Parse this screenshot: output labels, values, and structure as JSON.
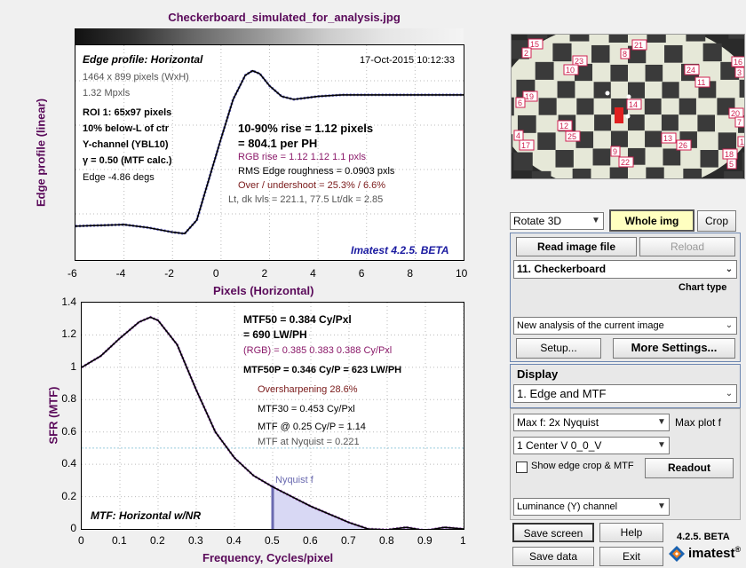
{
  "window_title": "Checkerboard_simulated_for_analysis.jpg",
  "edge_plot": {
    "title": "Edge profile: Horizontal",
    "timestamp": "17-Oct-2015 10:12:33",
    "dims": "1464 x 899 pixels (WxH)",
    "mpxls": "1.32 Mpxls",
    "roi": "ROI 1:  65x97 pixels",
    "pos": "10% below-L of ctr",
    "channel": "Y-channel  (YBL10)",
    "gamma": "γ = 0.50 (MTF calc.)",
    "edge_angle": "Edge -4.86 degs",
    "rise_1": "10-90% rise = 1.12 pixels",
    "rise_2": "= 804.1 per PH",
    "rgb_rise": "RGB rise = 1.12  1.12  1.1  pxls",
    "rms": "RMS Edge roughness = 0.0903 pxls",
    "over_under": "Over / undershoot = 25.3% / 6.6%",
    "levels": "Lt, dk lvls = 221.1, 77.5   Lt/dk = 2.85",
    "version": "Imatest 4.2.5. BETA",
    "ylabel": "Edge profile (linear)",
    "xlabel": "Pixels (Horizontal)",
    "xticks": [
      "-6",
      "-4",
      "-2",
      "0",
      "2",
      "4",
      "6",
      "8",
      "10"
    ]
  },
  "mtf_plot": {
    "mtf50_1": "MTF50 = 0.384 Cy/Pxl",
    "mtf50_2": "= 690 LW/PH",
    "rgb": "(RGB) = 0.385  0.383  0.388 Cy/Pxl",
    "mtf50p": "MTF50P = 0.346 Cy/P = 623 LW/PH",
    "oversharp": "Oversharpening 28.6%",
    "mtf30": "MTF30 = 0.453 Cy/Pxl",
    "mtf_at": "MTF @ 0.25 Cy/P = 1.14",
    "mtf_nyq": "MTF at Nyquist = 0.221",
    "nyquist_label": "Nyquist f",
    "bottom_title": "MTF: Horizontal w/NR",
    "ylabel": "SFR (MTF)",
    "xlabel": "Frequency, Cycles/pixel",
    "yticks": [
      "1.4",
      "1.2",
      "1",
      "0.8",
      "0.6",
      "0.4",
      "0.2",
      "0"
    ],
    "xticks": [
      "0",
      "0.1",
      "0.2",
      "0.3",
      "0.4",
      "0.5",
      "0.6",
      "0.7",
      "0.8",
      "0.9",
      "1"
    ]
  },
  "thumbnail_labels": [
    "15",
    "2",
    "21",
    "8",
    "23",
    "10",
    "24",
    "11",
    "16",
    "3",
    "19",
    "6",
    "14",
    "12",
    "25",
    "20",
    "7",
    "4",
    "17",
    "9",
    "22",
    "13",
    "26",
    "18",
    "5",
    "1"
  ],
  "controls": {
    "rotate": "Rotate 3D",
    "whole_img": "Whole img",
    "crop": "Crop",
    "read_image": "Read image file",
    "reload": "Reload",
    "chart_select": "11. Checkerboard",
    "chart_type_label": "Chart type",
    "analysis_select": "New analysis of the current image",
    "setup": "Setup...",
    "more_settings": "More Settings...",
    "display_label": "Display",
    "display_select": "1.  Edge and MTF",
    "maxf_select": "Max f:   2x Nyquist",
    "max_plot_label": "Max plot f",
    "center_select": "1  Center  V     0_0_V",
    "show_edge_label": "Show edge crop & MTF",
    "readout": "Readout",
    "channel_select": "Luminance (Y) channel",
    "save_screen": "Save screen",
    "help": "Help",
    "save_data": "Save data",
    "exit": "Exit",
    "beta": "4.2.5. BETA",
    "brand": "imatest",
    "reg": "®"
  },
  "chart_data": [
    {
      "type": "line",
      "title": "Edge profile: Horizontal",
      "xlabel": "Pixels (Horizontal)",
      "ylabel": "Edge profile (linear)",
      "xlim": [
        -6,
        10
      ],
      "x": [
        -6,
        -4,
        -3,
        -2,
        -1.5,
        -1,
        -0.5,
        0,
        0.5,
        1,
        1.3,
        1.6,
        2,
        2.5,
        3,
        3.5,
        4,
        5,
        6,
        7,
        8,
        10
      ],
      "y": [
        0.04,
        0.05,
        0.03,
        0.0,
        -0.01,
        0.08,
        0.35,
        0.62,
        0.88,
        1.04,
        1.07,
        1.05,
        0.97,
        0.9,
        0.88,
        0.89,
        0.9,
        0.91,
        0.91,
        0.91,
        0.91,
        0.91
      ]
    },
    {
      "type": "line",
      "title": "MTF: Horizontal w/NR",
      "xlabel": "Frequency, Cycles/pixel",
      "ylabel": "SFR (MTF)",
      "xlim": [
        0,
        1
      ],
      "ylim": [
        0,
        1.4
      ],
      "x": [
        0,
        0.05,
        0.1,
        0.15,
        0.18,
        0.2,
        0.25,
        0.3,
        0.35,
        0.4,
        0.45,
        0.5,
        0.55,
        0.6,
        0.65,
        0.7,
        0.75,
        0.8,
        0.85,
        0.9,
        0.95,
        1.0
      ],
      "y": [
        1.0,
        1.07,
        1.18,
        1.28,
        1.31,
        1.29,
        1.14,
        0.86,
        0.6,
        0.44,
        0.33,
        0.26,
        0.2,
        0.14,
        0.09,
        0.04,
        0.0,
        -0.005,
        0.01,
        -0.01,
        0.01,
        0.0
      ]
    }
  ]
}
